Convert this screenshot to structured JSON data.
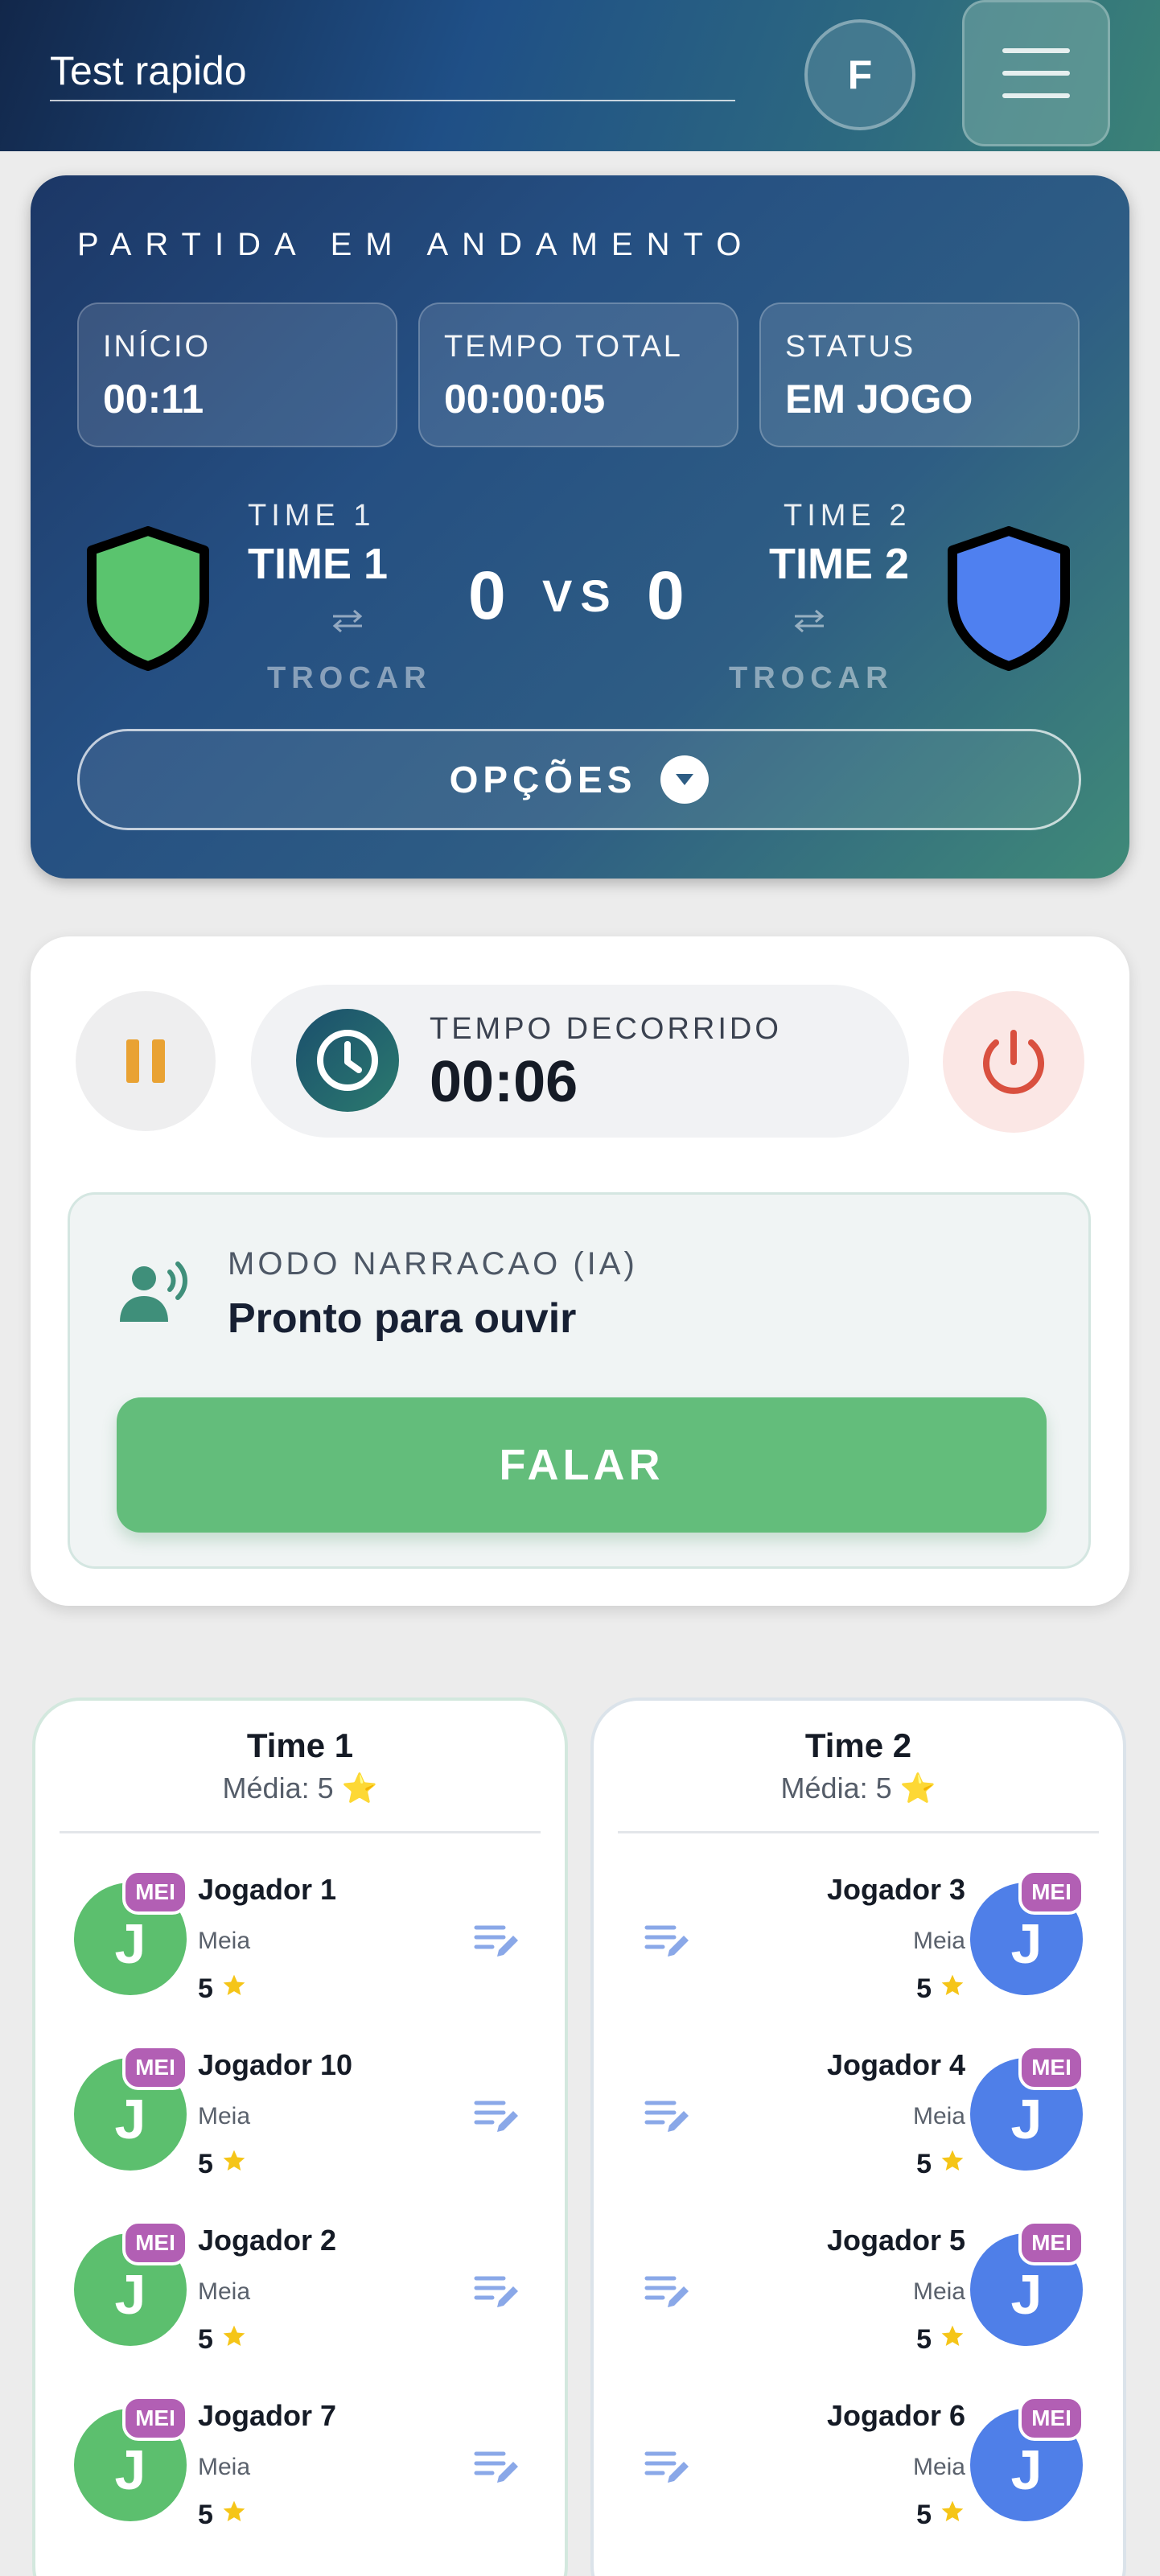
{
  "header": {
    "match_title": "Test rapido",
    "avatar_initial": "F",
    "menu_icon": "hamburger-menu-icon"
  },
  "match": {
    "heading": "PARTIDA EM ANDAMENTO",
    "info": [
      {
        "label": "INÍCIO",
        "value": "00:11"
      },
      {
        "label": "TEMPO TOTAL",
        "value": "00:00:05"
      },
      {
        "label": "STATUS",
        "value": "EM JOGO"
      }
    ],
    "team1": {
      "label": "TIME 1",
      "name": "TIME 1",
      "score": "0",
      "color": "#5ac46e",
      "swap_label": "TROCAR"
    },
    "team2": {
      "label": "TIME 2",
      "name": "TIME 2",
      "score": "0",
      "color": "#4f80f0",
      "swap_label": "TROCAR"
    },
    "vs": "VS",
    "options_label": "OPÇÕES"
  },
  "timer": {
    "elapsed_label": "TEMPO DECORRIDO",
    "elapsed_value": "00:06",
    "pause_color": "#e9a233",
    "stop_color": "#d9503f"
  },
  "narration": {
    "label": "MODO NARRACAO (IA)",
    "status": "Pronto para ouvir",
    "talk_button": "FALAR",
    "accent": "#63bd7b"
  },
  "teams": [
    {
      "title": "Time 1",
      "average": "Média: 5 ⭐",
      "avatar_color": "#5cbf6e",
      "players": [
        {
          "initial": "J",
          "badge": "MEI",
          "name": "Jogador 1",
          "position": "Meia",
          "rating": "5"
        },
        {
          "initial": "J",
          "badge": "MEI",
          "name": "Jogador 10",
          "position": "Meia",
          "rating": "5"
        },
        {
          "initial": "J",
          "badge": "MEI",
          "name": "Jogador 2",
          "position": "Meia",
          "rating": "5"
        },
        {
          "initial": "J",
          "badge": "MEI",
          "name": "Jogador 7",
          "position": "Meia",
          "rating": "5"
        }
      ]
    },
    {
      "title": "Time 2",
      "average": "Média: 5 ⭐",
      "avatar_color": "#4f7fe8",
      "players": [
        {
          "initial": "J",
          "badge": "MEI",
          "name": "Jogador 3",
          "position": "Meia",
          "rating": "5"
        },
        {
          "initial": "J",
          "badge": "MEI",
          "name": "Jogador 4",
          "position": "Meia",
          "rating": "5"
        },
        {
          "initial": "J",
          "badge": "MEI",
          "name": "Jogador 5",
          "position": "Meia",
          "rating": "5"
        },
        {
          "initial": "J",
          "badge": "MEI",
          "name": "Jogador 6",
          "position": "Meia",
          "rating": "5"
        }
      ]
    }
  ]
}
